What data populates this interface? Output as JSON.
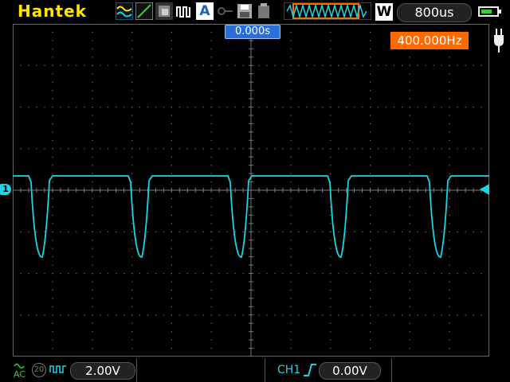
{
  "header": {
    "brand": "Hantek",
    "mode_letter": "A",
    "window_letter": "W",
    "timebase": "800us",
    "battery_level": 0.7
  },
  "screen": {
    "trigger_time": "0.000s",
    "frequency": "400.000Hz",
    "channel_marker": "1"
  },
  "footer": {
    "coupling": "AC",
    "bandwidth_badge": "20",
    "ch_volts": "2.00V",
    "trigger_source": "CH1",
    "trigger_level": "0.00V"
  },
  "colors": {
    "trace": "#19d6e6",
    "brand": "#ffe600",
    "freq_badge": "#ff6a00",
    "trigger_badge": "#2a6fd9"
  }
}
